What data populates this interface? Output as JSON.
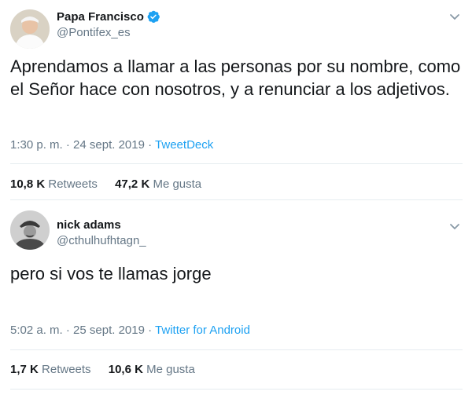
{
  "tweets": [
    {
      "name": "Papa Francisco",
      "handle": "@Pontifex_es",
      "verified": true,
      "text": "Aprendamos a llamar a las personas por su nombre, como el Señor hace con nosotros, y a renunciar a los adjetivos.",
      "time": "1:30 p. m.",
      "date": "24 sept. 2019",
      "source": "TweetDeck",
      "retweets_count": "10,8 K",
      "retweets_label": "Retweets",
      "likes_count": "47,2 K",
      "likes_label": "Me gusta"
    },
    {
      "name": "nick adams",
      "handle": "@cthulhufhtagn_",
      "verified": false,
      "text": "pero si vos te llamas jorge",
      "time": "5:02 a. m.",
      "date": "25 sept. 2019",
      "source": "Twitter for Android",
      "retweets_count": "1,7 K",
      "retweets_label": "Retweets",
      "likes_count": "10,6 K",
      "likes_label": "Me gusta"
    }
  ],
  "separator": "·",
  "colors": {
    "text": "#14171a",
    "secondary": "#657786",
    "link": "#1da1f2",
    "verified": "#1da1f2",
    "divider": "#e6ecf0"
  },
  "icons": [
    "verified-badge-icon",
    "chevron-down-icon"
  ]
}
